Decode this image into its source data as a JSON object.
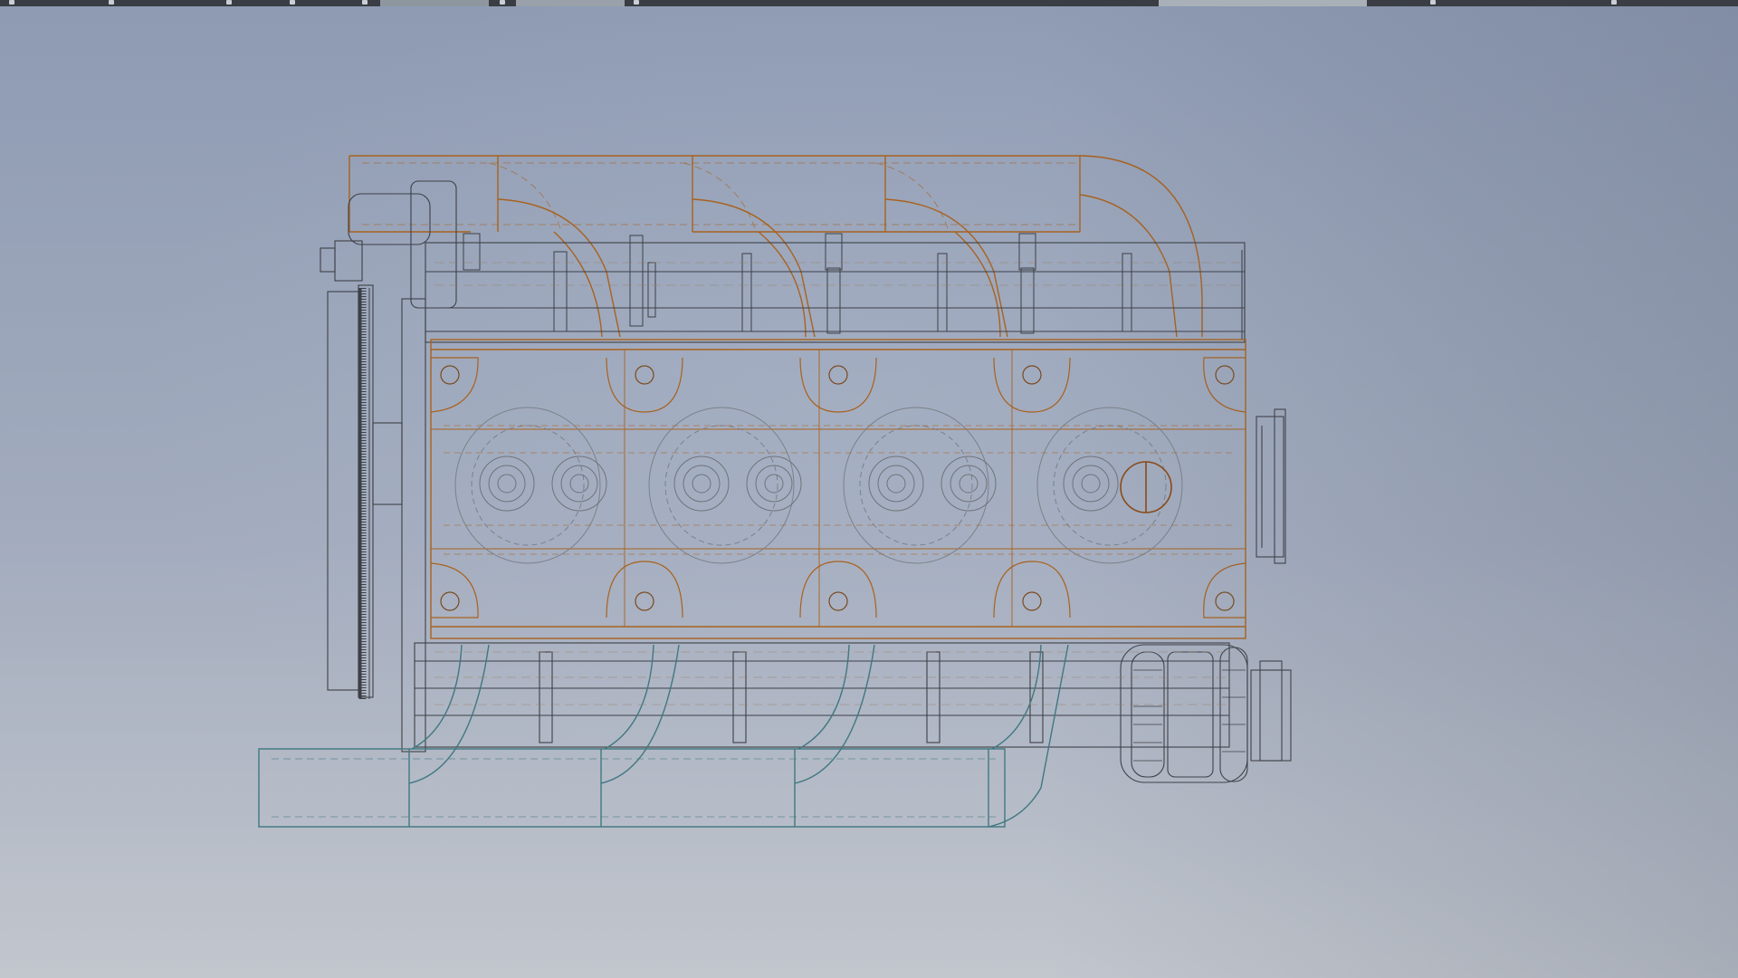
{
  "app": {
    "view": "wireframe-3d-viewport"
  },
  "colors": {
    "background_top": "#8e9bb3",
    "background_bottom": "#c2c6cd",
    "line_dark": "#3d4046",
    "line_gray": "#7c8088",
    "line_orange": "#a8621e",
    "line_teal": "#3f7880"
  },
  "toolbar_icons": [
    "app-menu-icon",
    "document-icon",
    "save-icon",
    "undo-icon",
    "redo-icon",
    "view-cube-icon",
    "help-icon",
    "user-icon"
  ]
}
